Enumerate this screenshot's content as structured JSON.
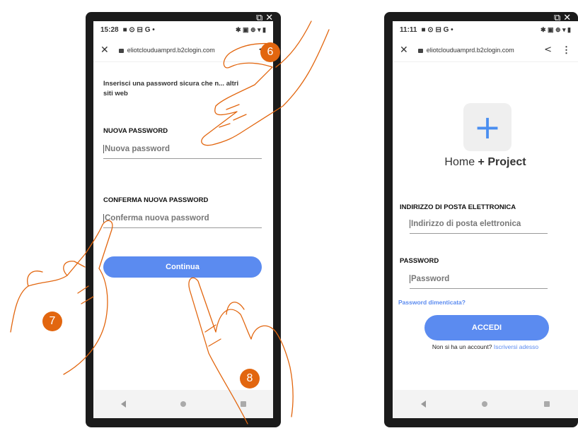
{
  "left_phone": {
    "status_time": "15:28",
    "status_icons": "■ ⊙ ⊟ G •",
    "status_right": "✱ ▣ ⊕ ▾ ▮",
    "url": "eliotclouduamprd.b2clogin.com",
    "intro_text": "Inserisci una password sicura che n... altri siti web",
    "new_password_label": "NUOVA PASSWORD",
    "new_password_placeholder": "Nuova password",
    "confirm_password_label": "CONFERMA NUOVA PASSWORD",
    "confirm_password_placeholder": "Conferma nuova password",
    "continue_label": "Continua"
  },
  "right_phone": {
    "status_time": "11:11",
    "status_icons": "■ ⊙ ⊟ G •",
    "status_right": "✱ ▣ ⊕ ▾ ▮",
    "url": "eliotclouduamprd.b2clogin.com",
    "logo_symbol": "+",
    "app_name_home": "Home",
    "app_name_plus": "+",
    "app_name_project": "Project",
    "email_label": "INDIRIZZO DI POSTA ELETTRONICA",
    "email_placeholder": "Indirizzo di posta elettronica",
    "password_label": "PASSWORD",
    "password_placeholder": "Password",
    "forgot_link": "Password dimenticata?",
    "login_label": "ACCEDI",
    "no_account_text": "Non si ha un account?",
    "signup_link": "Iscriversi adesso"
  },
  "badges": {
    "step6": "6",
    "step7": "7",
    "step8": "8"
  },
  "colors": {
    "accent": "#5b8bf0",
    "badge": "#e2660f",
    "link": "#5b8bf0"
  }
}
